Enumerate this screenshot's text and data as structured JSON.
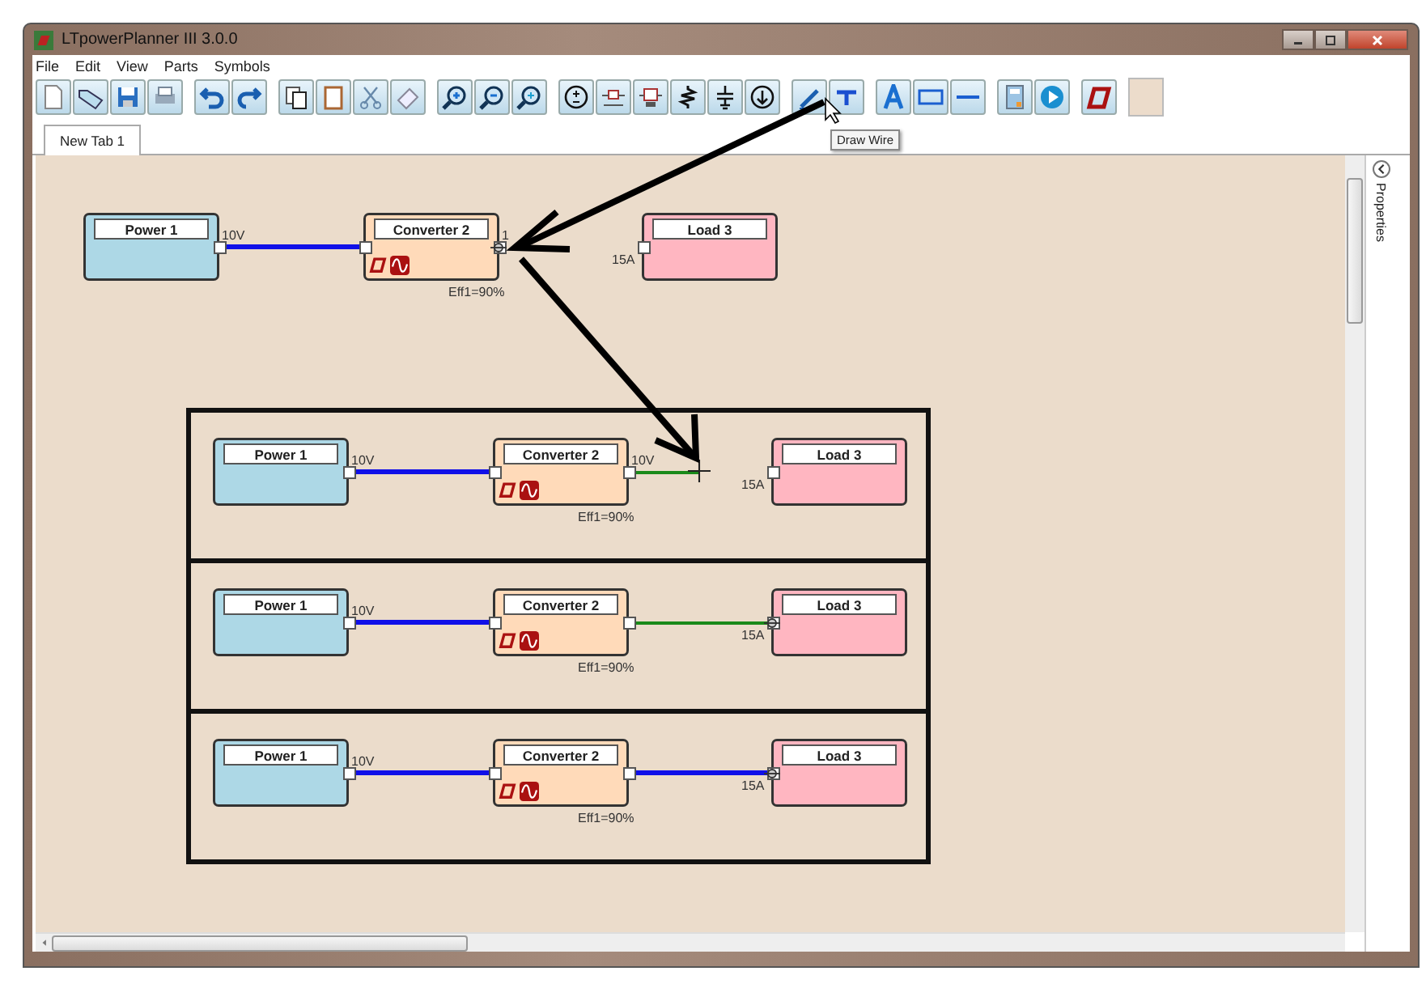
{
  "window": {
    "title": "LTpowerPlanner III 3.0.0"
  },
  "menu": [
    {
      "label": "File"
    },
    {
      "label": "Edit"
    },
    {
      "label": "View"
    },
    {
      "label": "Parts"
    },
    {
      "label": "Symbols"
    }
  ],
  "tooltip": "Draw Wire",
  "tabs": [
    {
      "label": "New Tab 1",
      "selected": true
    }
  ],
  "side_panel": {
    "label": "Properties"
  },
  "diagrams": [
    {
      "framed": false,
      "power": {
        "title": "Power 1",
        "output": "10V"
      },
      "converter": {
        "title": "Converter 2",
        "output": "1",
        "efficiency": "Eff1=90%"
      },
      "load": {
        "title": "Load 3",
        "input": "15A"
      },
      "output_wire": {
        "kind": "none"
      }
    },
    {
      "framed": true,
      "power": {
        "title": "Power 1",
        "output": "10V"
      },
      "converter": {
        "title": "Converter 2",
        "output": "10V",
        "efficiency": "Eff1=90%"
      },
      "load": {
        "title": "Load 3",
        "input": "15A"
      },
      "output_wire": {
        "kind": "pending"
      }
    },
    {
      "framed": true,
      "power": {
        "title": "Power 1",
        "output": "10V"
      },
      "converter": {
        "title": "Converter 2",
        "efficiency": "Eff1=90%"
      },
      "load": {
        "title": "Load 3",
        "input": "15A"
      },
      "output_wire": {
        "kind": "connected"
      }
    },
    {
      "framed": true,
      "power": {
        "title": "Power 1",
        "output": "10V"
      },
      "converter": {
        "title": "Converter 2",
        "efficiency": "Eff1=90%"
      },
      "load": {
        "title": "Load 3",
        "input": "15A"
      },
      "output_wire": {
        "kind": "bus"
      }
    }
  ]
}
